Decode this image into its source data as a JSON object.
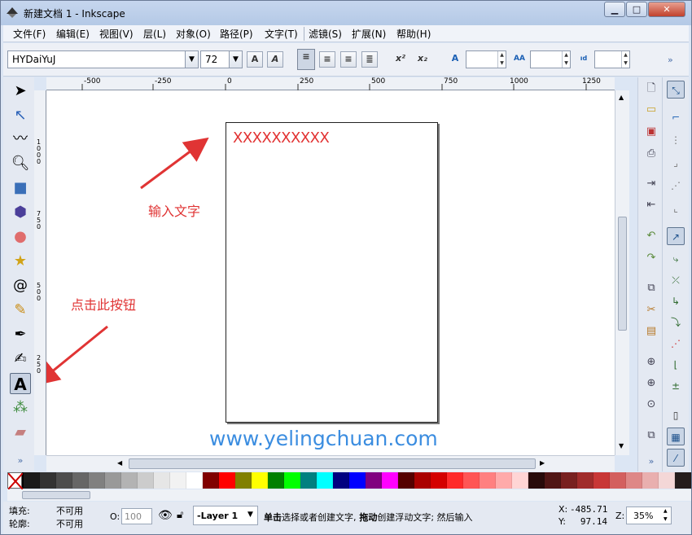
{
  "window": {
    "title": "新建文档 1 - Inkscape",
    "minimize": "▁",
    "maximize": "□",
    "close": "✕"
  },
  "menu": [
    "文件(F)",
    "编辑(E)",
    "视图(V)",
    "层(L)",
    "对象(O)",
    "路径(P)",
    "文字(T)",
    "滤镜(S)",
    "扩展(N)",
    "帮助(H)"
  ],
  "text_controls": {
    "font_family": "HYDaiYuJ",
    "font_size": "72",
    "more": "»"
  },
  "ruler_h_labels": [
    "-500",
    "-250",
    "0",
    "250",
    "500",
    "750",
    "1000",
    "1250"
  ],
  "ruler_v_labels": [
    "1000",
    "750",
    "500",
    "250"
  ],
  "canvas": {
    "text_object": "XXXXXXXXXX",
    "note_input": "输入文字",
    "note_click": "点击此按钮",
    "watermark": "www.yelingchuan.com"
  },
  "status": {
    "fill_label": "填充:",
    "fill_value": "不可用",
    "stroke_label": "轮廓:",
    "stroke_value": "不可用",
    "opacity_label": "O:",
    "opacity_value": "100",
    "layer": "-Layer 1",
    "message_b1": "单击",
    "message_t1": "选择或者创建文字,",
    "message_b2": " 拖动",
    "message_t2": "创建浮动文字; 然后输入",
    "x_label": "X:",
    "x_value": "-485.71",
    "y_label": "Y:",
    "y_value": "97.14",
    "zoom_label": "Z:",
    "zoom_value": "35%"
  },
  "colors": {
    "accent_red": "#e03434",
    "watermark_blue": "#3b8de0"
  },
  "palette": [
    "#000000",
    "#1a1a1a",
    "#333333",
    "#4d4d4d",
    "#666666",
    "#808080",
    "#999999",
    "#b3b3b3",
    "#cccccc",
    "#e6e6e6",
    "#f2f2f2",
    "#ffffff",
    "#800000",
    "#ff0000",
    "#808000",
    "#ffff00",
    "#008000",
    "#00ff00",
    "#008080",
    "#00ffff",
    "#000080",
    "#0000ff",
    "#800080",
    "#ff00ff",
    "#550000",
    "#aa0000",
    "#d40000",
    "#ff2a2a",
    "#ff5555",
    "#ff8080",
    "#ffaaaa",
    "#ffd5d5",
    "#280b0b",
    "#501616",
    "#782121",
    "#a02c2c",
    "#c83737",
    "#d35f5f",
    "#de8787",
    "#e9afaf",
    "#f4d7d7",
    "#241c1c"
  ]
}
